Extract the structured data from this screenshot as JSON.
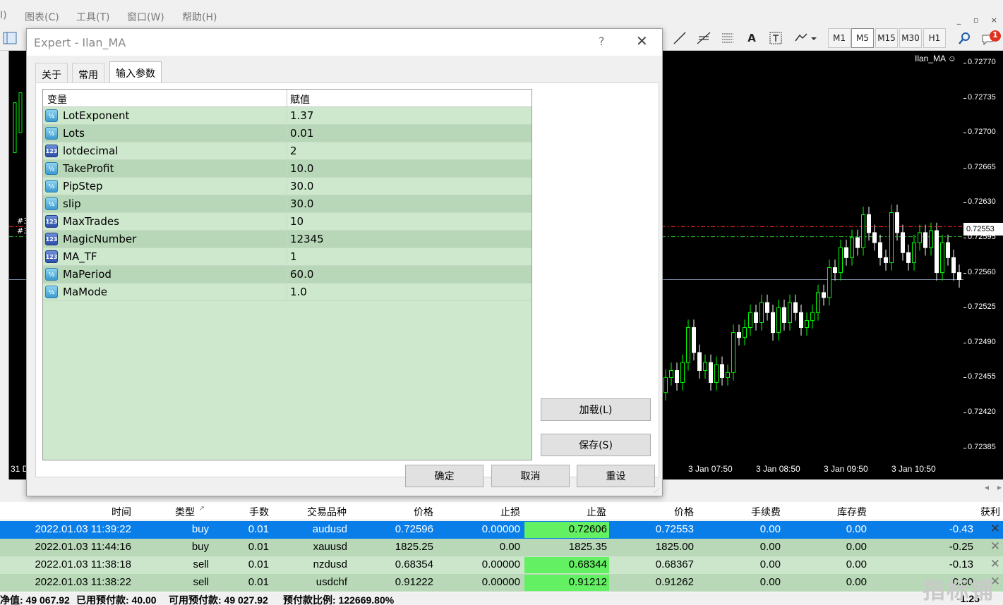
{
  "menu": [
    "I)",
    "图表(C)",
    "工具(T)",
    "窗口(W)",
    "帮助(H)"
  ],
  "window_controls": [
    "_",
    "▫",
    "×"
  ],
  "toolbar": {
    "timeframes": [
      "M1",
      "M5",
      "M15",
      "M30",
      "H1"
    ],
    "active_timeframe": "M5",
    "text_tool": "A",
    "notification_count": "1"
  },
  "chart": {
    "ea_label": "Ilan_MA",
    "price_levels": [
      "0.72770",
      "0.72735",
      "0.72700",
      "0.72665",
      "0.72630",
      "0.72595",
      "0.72560",
      "0.72525",
      "0.72490",
      "0.72455",
      "0.72420",
      "0.72385"
    ],
    "current_price": "0.72553",
    "time_labels": [
      "31 D",
      "3 Jan 07:50",
      "3 Jan 08:50",
      "3 Jan 09:50",
      "3 Jan 10:50"
    ],
    "left_markers": [
      "#3",
      "#3"
    ],
    "colors": {
      "bull": "#00ff00",
      "bear": "#ffffff",
      "tp_line": "#ff2020",
      "open_line": "#20c020"
    }
  },
  "dialog": {
    "title": "Expert - Ilan_MA",
    "help": "?",
    "close": "✕",
    "tabs": [
      "关于",
      "常用",
      "输入参数"
    ],
    "active_tab": "输入参数",
    "table_headers": [
      "变量",
      "赋值"
    ],
    "params": [
      {
        "name": "LotExponent",
        "value": "1.37",
        "type": "double"
      },
      {
        "name": "Lots",
        "value": "0.01",
        "type": "double"
      },
      {
        "name": "lotdecimal",
        "value": "2",
        "type": "int"
      },
      {
        "name": "TakeProfit",
        "value": "10.0",
        "type": "double"
      },
      {
        "name": "PipStep",
        "value": "30.0",
        "type": "double"
      },
      {
        "name": "slip",
        "value": "30.0",
        "type": "double"
      },
      {
        "name": "MaxTrades",
        "value": "10",
        "type": "int"
      },
      {
        "name": "MagicNumber",
        "value": "12345",
        "type": "int"
      },
      {
        "name": "MA_TF",
        "value": "1",
        "type": "int"
      },
      {
        "name": "MaPeriod",
        "value": "60.0",
        "type": "double"
      },
      {
        "name": "MaMode",
        "value": "1.0",
        "type": "double"
      }
    ],
    "icon_labels": {
      "double": "½",
      "int": "123"
    },
    "buttons": {
      "load": "加载(L)",
      "save": "保存(S)",
      "ok": "确定",
      "cancel": "取消",
      "reset": "重设"
    }
  },
  "terminal": {
    "headers": [
      "时间",
      "类型",
      "手数",
      "交易品种",
      "价格",
      "止损",
      "止盈",
      "价格",
      "手续费",
      "库存费",
      "获利"
    ],
    "sort_glyph": "↗",
    "rows": [
      {
        "time": "2022.01.03 11:39:22",
        "type": "buy",
        "lots": "0.01",
        "symbol": "audusd",
        "open": "0.72596",
        "sl": "0.00000",
        "tp": "0.72606",
        "price": "0.72553",
        "commission": "0.00",
        "swap": "0.00",
        "profit": "-0.43",
        "selected": true,
        "tp_hl": true
      },
      {
        "time": "2022.01.03 11:44:16",
        "type": "buy",
        "lots": "0.01",
        "symbol": "xauusd",
        "open": "1825.25",
        "sl": "0.00",
        "tp": "1825.35",
        "price": "1825.00",
        "commission": "0.00",
        "swap": "0.00",
        "profit": "-0.25",
        "selected": false,
        "tp_hl": false
      },
      {
        "time": "2022.01.03 11:38:18",
        "type": "sell",
        "lots": "0.01",
        "symbol": "nzdusd",
        "open": "0.68354",
        "sl": "0.00000",
        "tp": "0.68344",
        "price": "0.68367",
        "commission": "0.00",
        "swap": "0.00",
        "profit": "-0.13",
        "selected": false,
        "tp_hl": true
      },
      {
        "time": "2022.01.03 11:38:22",
        "type": "sell",
        "lots": "0.01",
        "symbol": "usdchf",
        "open": "0.91222",
        "sl": "0.00000",
        "tp": "0.91212",
        "price": "0.91262",
        "commission": "0.00",
        "swap": "0.00",
        "profit": "0.00",
        "selected": false,
        "tp_hl": true
      }
    ],
    "status": {
      "equity": "净值: 49 067.92",
      "margin": "已用预付款: 40.00",
      "free": "可用预付款: 49 027.92",
      "level": "预付款比例: 122669.80%",
      "total": "-1.25"
    },
    "close_glyph": "✕"
  },
  "watermark": "指标铺"
}
